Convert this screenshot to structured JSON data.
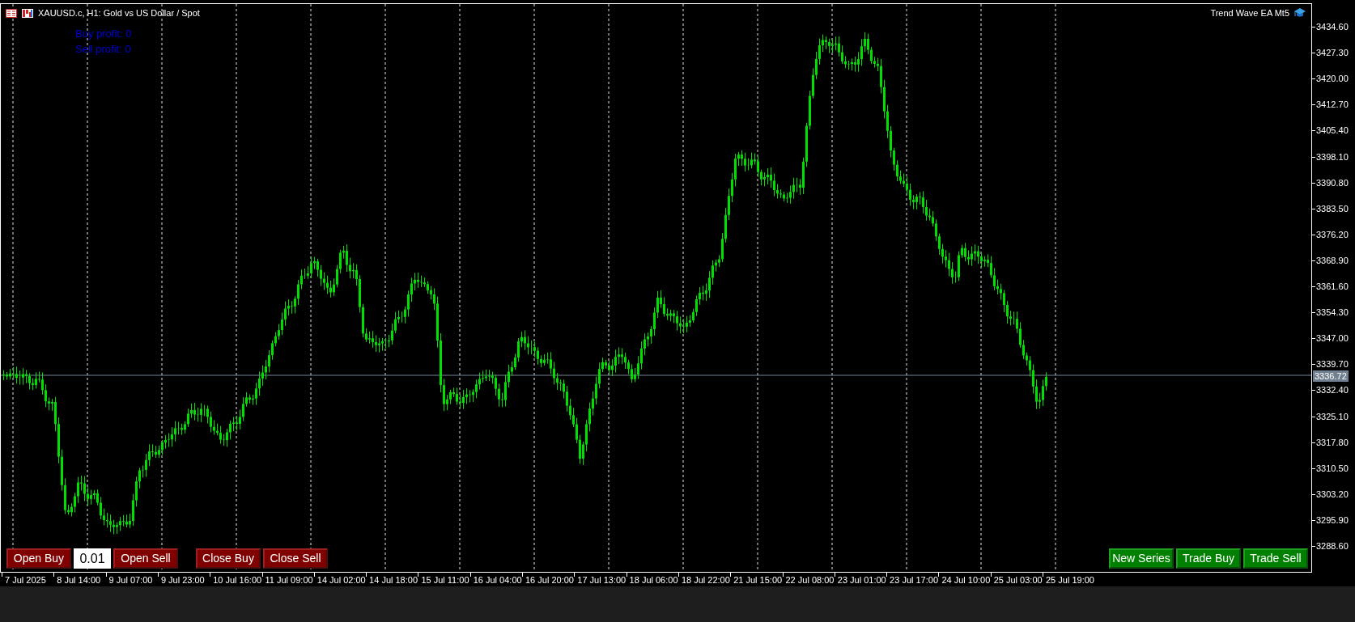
{
  "window": {
    "title": "XAUUSD.c, H1:  Gold vs US Dollar / Spot"
  },
  "overlay_labels": [
    {
      "text": "Buy profit: 0"
    },
    {
      "text": "Sell profit: 0"
    }
  ],
  "expert_name": "Trend Wave EA Mt5",
  "price_axis": {
    "ticks": [
      "3434.60",
      "3427.30",
      "3420.00",
      "3412.70",
      "3405.40",
      "3398.10",
      "3390.80",
      "3383.50",
      "3376.20",
      "3368.90",
      "3361.60",
      "3354.30",
      "3347.00",
      "3339.70",
      "3332.40",
      "3325.10",
      "3317.80",
      "3310.50",
      "3303.20",
      "3295.90",
      "3288.60"
    ],
    "current_price": "3336.72"
  },
  "time_axis": {
    "ticks": [
      "7 Jul 2025",
      "8 Jul 14:00",
      "9 Jul 07:00",
      "9 Jul 23:00",
      "10 Jul 16:00",
      "11 Jul 09:00",
      "14 Jul 02:00",
      "14 Jul 18:00",
      "15 Jul 11:00",
      "16 Jul 04:00",
      "16 Jul 20:00",
      "17 Jul 13:00",
      "18 Jul 06:00",
      "18 Jul 22:00",
      "21 Jul 15:00",
      "22 Jul 08:00",
      "23 Jul 01:00",
      "23 Jul 17:00",
      "24 Jul 10:00",
      "25 Jul 03:00",
      "25 Jul 19:00"
    ]
  },
  "left_controls": [
    {
      "kind": "button",
      "label": "Open Buy"
    },
    {
      "kind": "field",
      "value": "0.01"
    },
    {
      "kind": "button",
      "label": "Open Sell"
    },
    {
      "kind": "gap"
    },
    {
      "kind": "button",
      "label": "Close Buy"
    },
    {
      "kind": "button",
      "label": "Close Sell"
    }
  ],
  "right_buttons": [
    {
      "label": "New Series"
    },
    {
      "label": "Trade Buy"
    },
    {
      "label": "Trade Sell"
    }
  ]
}
